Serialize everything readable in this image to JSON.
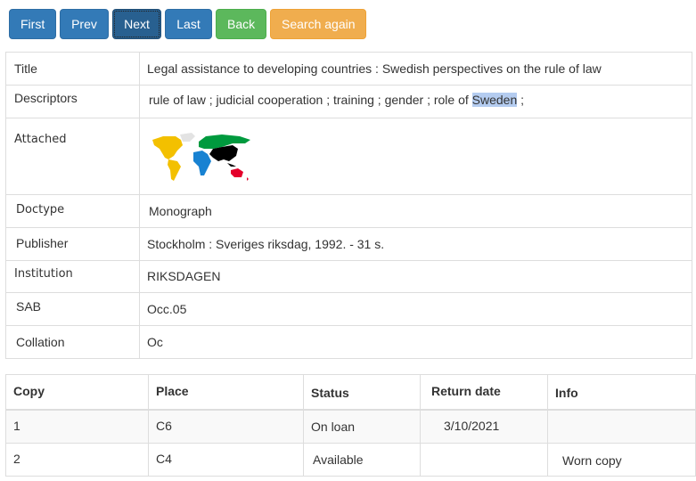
{
  "toolbar": {
    "first": "First",
    "prev": "Prev",
    "next": "Next",
    "last": "Last",
    "back": "Back",
    "search_again": "Search again"
  },
  "details": {
    "title_label": "Title",
    "title_value": "Legal assistance to developing countries : Swedish perspectives on the rule of law",
    "descriptors_label": "Descriptors",
    "descriptors_before": "rule of law ; judicial cooperation ; training ; gender ; role of ",
    "descriptors_highlight": "Sweden",
    "descriptors_after": " ;",
    "attached_label": "Attached",
    "attached_icon": "world-map-icon",
    "doctype_label": "Doctype",
    "doctype_value": "Monograph",
    "publisher_label": "Publisher",
    "publisher_value": "Stockholm : Sveriges riksdag, 1992. - 31 s.",
    "institution_label": "Institution",
    "institution_value": "RIKSDAGEN",
    "sab_label": "SAB",
    "sab_value": "Occ.05",
    "collation_label": "Collation",
    "collation_value": "Oc"
  },
  "copies": {
    "headers": [
      "Copy",
      "Place",
      "Status",
      "Return date",
      "Info"
    ],
    "rows": [
      {
        "copy": "1",
        "place": "C6",
        "status": "On loan",
        "return_date": "3/10/2021",
        "info": ""
      },
      {
        "copy": "2",
        "place": "C4",
        "status": "Available",
        "return_date": "",
        "info": "Worn copy"
      }
    ]
  },
  "colors": {
    "primary": "#337ab7",
    "primary_active": "#286090",
    "success": "#5cb85c",
    "warning": "#f0ad4e",
    "highlight": "#b4ccf0"
  }
}
